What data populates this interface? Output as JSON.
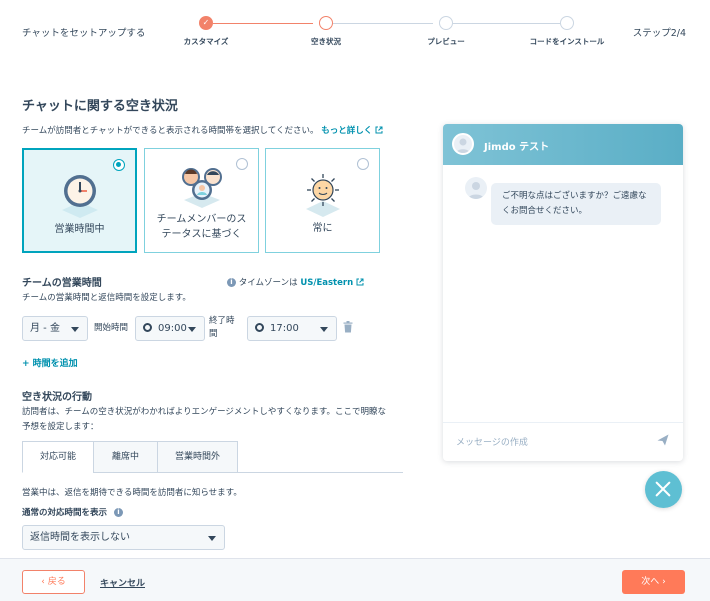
{
  "header": {
    "title": "チャットをセットアップする",
    "step_count": "ステップ2/4",
    "steps": [
      {
        "label": "カスタマイズ",
        "state": "done"
      },
      {
        "label": "空き状況",
        "state": "active"
      },
      {
        "label": "プレビュー",
        "state": "pending"
      },
      {
        "label": "コードをインストール",
        "state": "pending"
      }
    ]
  },
  "availability": {
    "title": "チャットに関する空き状況",
    "description": "チームが訪問者とチャットができると表示される時間帯を選択してください。",
    "learn_more": "もっと詳しく",
    "options": [
      {
        "label": "営業時間中",
        "selected": true,
        "icon": "clock-icon"
      },
      {
        "label": "チームメンバーのステータスに基づく",
        "label_line1": "チームメンバーのス",
        "label_line2": "テータスに基づく",
        "selected": false,
        "icon": "team-avatars-icon"
      },
      {
        "label": "常に",
        "selected": false,
        "icon": "sun-face-icon"
      }
    ]
  },
  "hours": {
    "title": "チームの営業時間",
    "description": "チームの営業時間と返信時間を設定します。",
    "timezone_label": "タイムゾーンは",
    "timezone_value": "US/Eastern",
    "days": "月 - 金",
    "start_label": "開始時間",
    "start_time": "09:00",
    "end_label_line1": "終了時",
    "end_label_line2": "間",
    "end_time": "17:00",
    "add_time": "+ 時間を追加"
  },
  "behavior": {
    "title": "空き状況の行動",
    "description_line1": "訪問者は、チームの空き状況がわかればよりエンゲージメントしやすくなります。ここで明瞭な",
    "description_line2": "予想を設定します：",
    "tabs": [
      "対応可能",
      "離席中",
      "営業時間外"
    ],
    "active_tab": "対応可能",
    "tab_description": "営業中は、返信を期待できる時間を訪問者に知らせます。",
    "response_label": "通常の対応時間を表示",
    "response_value": "返信時間を表示しない"
  },
  "footer": {
    "back": "戻る",
    "cancel": "キャンセル",
    "next": "次へ"
  },
  "chat_preview": {
    "title": "Jimdo テスト",
    "message": "ご不明な点はございますか？ご遠慮なくお問合せください。",
    "composer_placeholder": "メッセージの作成"
  },
  "colors": {
    "accent": "#ff7a59",
    "teal": "#00a4bd",
    "text": "#33475b"
  }
}
